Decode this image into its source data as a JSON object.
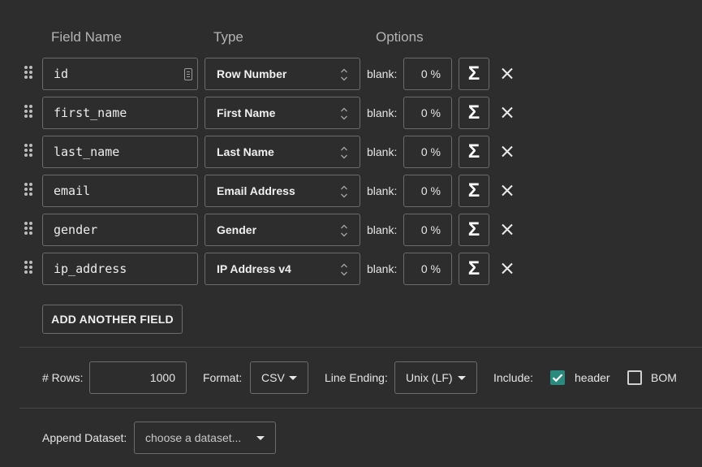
{
  "headers": {
    "field_name": "Field Name",
    "type": "Type",
    "options": "Options"
  },
  "fields": [
    {
      "name": "id",
      "type": "Row Number",
      "blank_label": "blank:",
      "blank_pct": "0 %",
      "sigma": "Σ",
      "has_hash_icon": true
    },
    {
      "name": "first_name",
      "type": "First Name",
      "blank_label": "blank:",
      "blank_pct": "0 %",
      "sigma": "Σ"
    },
    {
      "name": "last_name",
      "type": "Last Name",
      "blank_label": "blank:",
      "blank_pct": "0 %",
      "sigma": "Σ"
    },
    {
      "name": "email",
      "type": "Email Address",
      "blank_label": "blank:",
      "blank_pct": "0 %",
      "sigma": "Σ"
    },
    {
      "name": "gender",
      "type": "Gender",
      "blank_label": "blank:",
      "blank_pct": "0 %",
      "sigma": "Σ"
    },
    {
      "name": "ip_address",
      "type": "IP Address v4",
      "blank_label": "blank:",
      "blank_pct": "0 %",
      "sigma": "Σ"
    }
  ],
  "add_field_label": "ADD ANOTHER FIELD",
  "options_bar": {
    "rows_label": "# Rows:",
    "rows_value": "1000",
    "format_label": "Format:",
    "format_value": "CSV",
    "line_ending_label": "Line Ending:",
    "line_ending_value": "Unix (LF)",
    "include_label": "Include:",
    "header_label": "header",
    "header_checked": true,
    "bom_label": "BOM",
    "bom_checked": false
  },
  "append": {
    "label": "Append Dataset:",
    "placeholder": "choose a dataset..."
  },
  "colors": {
    "background": "#2d2d2d",
    "border": "#6c6c6c",
    "accent_check": "#2a8a7e"
  }
}
